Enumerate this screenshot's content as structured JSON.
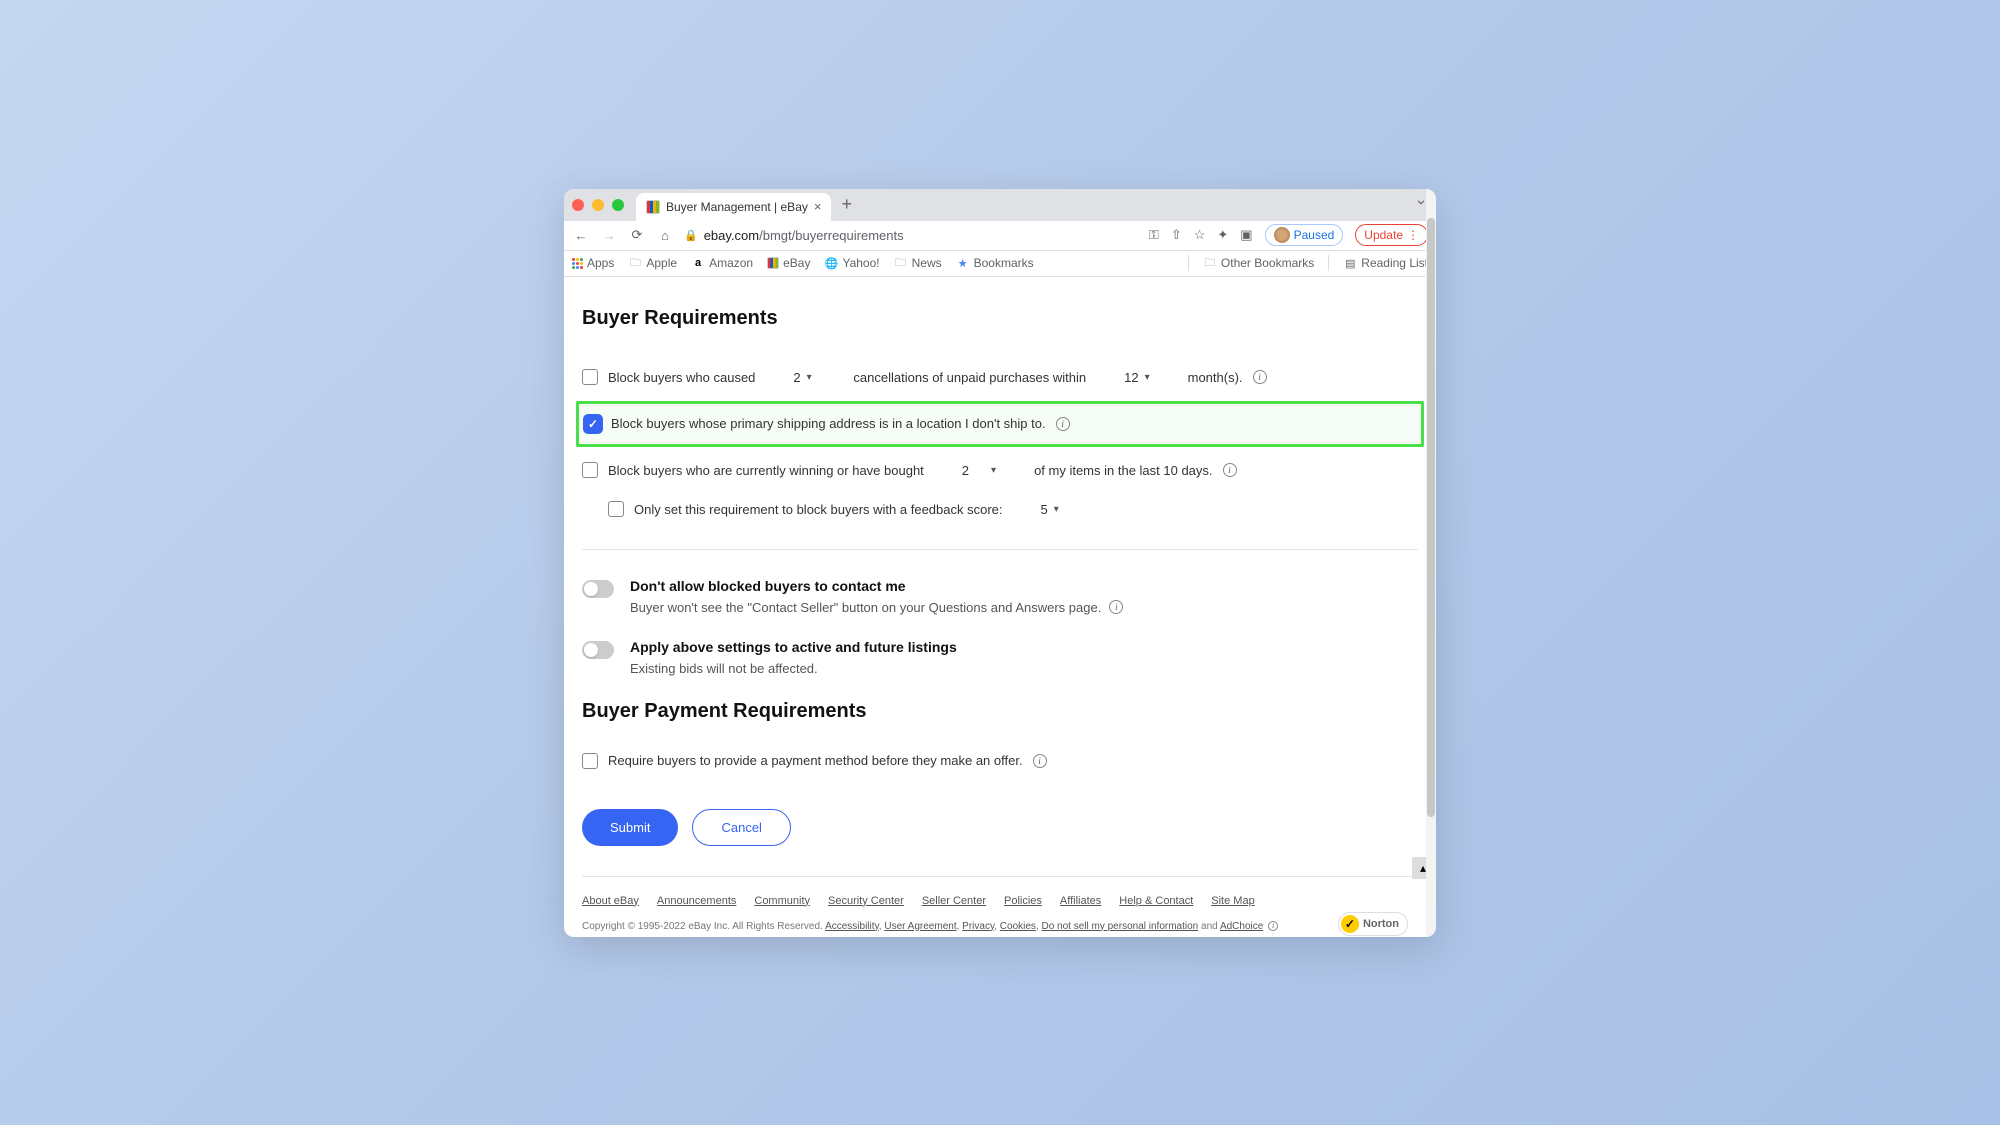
{
  "browser": {
    "tab_title": "Buyer Management | eBay",
    "url_host": "ebay.com",
    "url_path": "/bmgt/buyerrequirements",
    "paused_label": "Paused",
    "update_label": "Update"
  },
  "bookmarks": {
    "apps": "Apps",
    "items": [
      "Apple",
      "Amazon",
      "eBay",
      "Yahoo!",
      "News",
      "Bookmarks"
    ],
    "other": "Other Bookmarks",
    "reading": "Reading List"
  },
  "page": {
    "heading": "Buyer Requirements",
    "row1_a": "Block buyers who caused",
    "row1_sel1": "2",
    "row1_b": "cancellations of unpaid purchases within",
    "row1_sel2": "12",
    "row1_c": "month(s).",
    "row2": "Block buyers whose primary shipping address is in a location I don't ship to.",
    "row3_a": "Block buyers who are currently winning or have bought",
    "row3_sel": "2",
    "row3_b": "of my items in the last 10 days.",
    "row4_a": "Only set this requirement to block buyers with a feedback score:",
    "row4_sel": "5",
    "toggle1_title": "Don't allow blocked buyers to contact me",
    "toggle1_desc": "Buyer won't see the \"Contact Seller\" button on your Questions and Answers page.",
    "toggle2_title": "Apply above settings to active and future listings",
    "toggle2_desc": "Existing bids will not be affected.",
    "heading2": "Buyer Payment Requirements",
    "row5": "Require buyers to provide a payment method before they make an offer.",
    "submit": "Submit",
    "cancel": "Cancel"
  },
  "footer": {
    "links": [
      "About eBay",
      "Announcements",
      "Community",
      "Security Center",
      "Seller Center",
      "Policies",
      "Affiliates",
      "Help & Contact",
      "Site Map"
    ],
    "copyright": "Copyright © 1995-2022 eBay Inc. All Rights Reserved. ",
    "legal": [
      "Accessibility",
      "User Agreement",
      "Privacy",
      "Cookies",
      "Do not sell my personal information"
    ],
    "and": " and ",
    "adchoice": "AdChoice",
    "norton": "Norton"
  }
}
